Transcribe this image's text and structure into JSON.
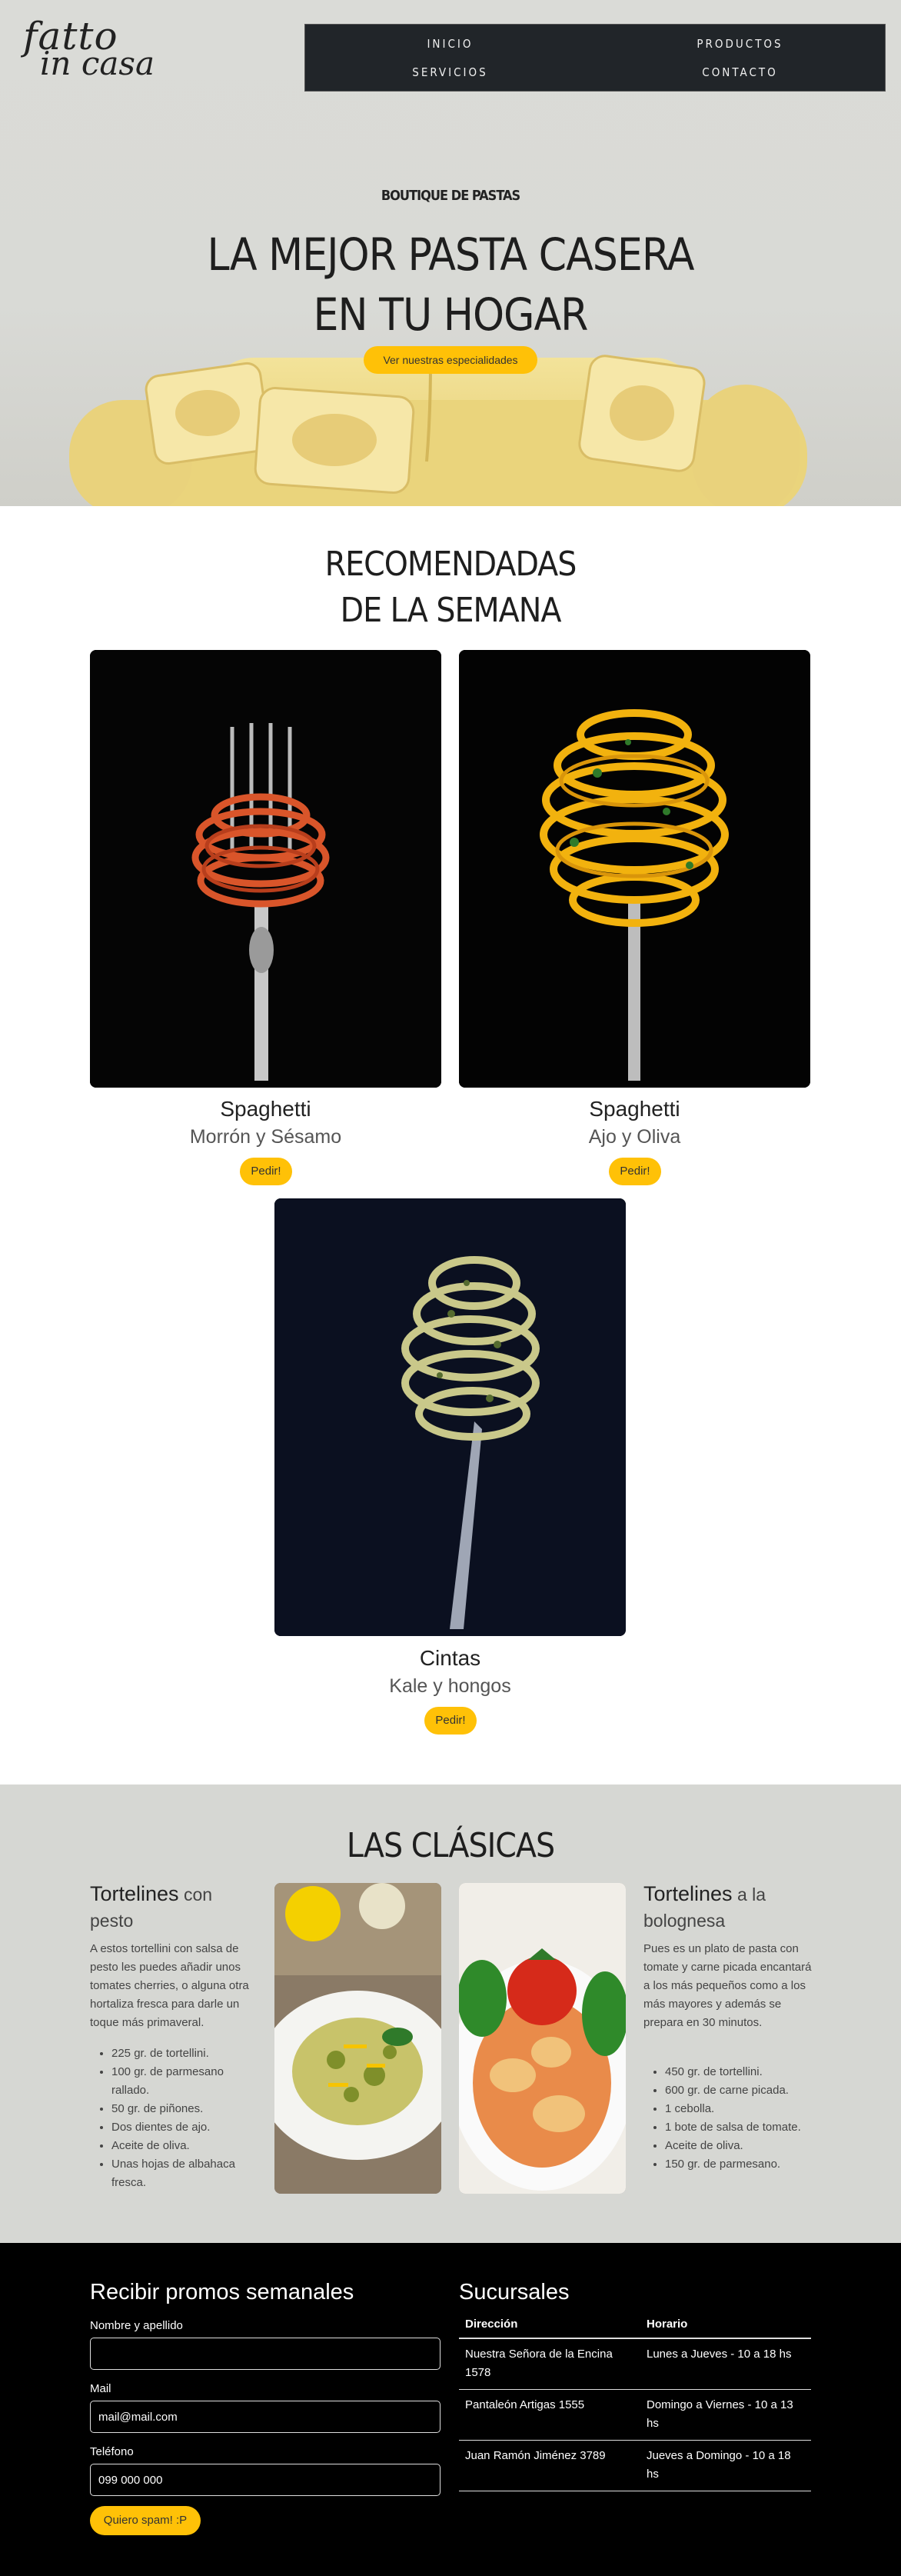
{
  "header": {
    "logo_line1": "fatto",
    "logo_line2": "in casa",
    "nav": [
      "INICIO",
      "PRODUCTOS",
      "SERVICIOS",
      "CONTACTO"
    ]
  },
  "hero": {
    "subtitle": "BOUTIQUE DE PASTAS",
    "title_line1": "LA MEJOR PASTA CASERA",
    "title_line2": "EN TU HOGAR",
    "button": "Ver nuestras especialidades"
  },
  "recomendadas": {
    "title_line1": "RECOMENDADAS",
    "title_line2": "DE LA SEMANA",
    "items": [
      {
        "name": "Spaghetti",
        "sub": "Morrón y Sésamo",
        "button": "Pedir!"
      },
      {
        "name": "Spaghetti",
        "sub": "Ajo y Oliva",
        "button": "Pedir!"
      },
      {
        "name": "Cintas",
        "sub": "Kale y hongos",
        "button": "Pedir!"
      }
    ]
  },
  "clasicas": {
    "title": "LAS CLÁSICAS",
    "left": {
      "name": "Tortelines",
      "name_rest": " con pesto",
      "description": "A estos tortellini con salsa de pesto les puedes añadir unos tomates cherries, o alguna otra hortaliza fresca para darle un toque más primaveral.",
      "ingredients": [
        "225 gr. de tortellini.",
        "100 gr. de parmesano rallado.",
        "50 gr. de piñones.",
        "Dos dientes de ajo.",
        "Aceite de oliva.",
        "Unas hojas de albahaca fresca."
      ]
    },
    "right": {
      "name": "Tortelines",
      "name_rest": " a la bolognesa",
      "description": "Pues es un plato de pasta con tomate y carne picada encantará a los más pequeños como a los más mayores y además se prepara en 30 minutos.",
      "ingredients": [
        "450 gr. de tortellini.",
        "600 gr. de carne picada.",
        "1 cebolla.",
        "1 bote de salsa de tomate.",
        "Aceite de oliva.",
        "150 gr. de parmesano."
      ]
    }
  },
  "footer": {
    "promo_title": "Recibir promos semanales",
    "name_label": "Nombre y apellido",
    "name_value": "",
    "mail_label": "Mail",
    "mail_placeholder": "mail@mail.com",
    "phone_label": "Teléfono",
    "phone_placeholder": "099 000 000",
    "submit": "Quiero spam! :P",
    "branches_title": "Sucursales",
    "table_headers": [
      "Dirección",
      "Horario"
    ],
    "rows": [
      [
        "Nuestra Señora de la Encina 1578",
        "Lunes a Jueves - 10 a 18 hs"
      ],
      [
        "Pantaleón Artigas 1555",
        "Domingo a Viernes - 10 a 13 hs"
      ],
      [
        "Juan Ramón Jiménez 3789",
        "Jueves a Domingo - 10 a 18 hs"
      ]
    ]
  },
  "colors": {
    "accent": "#ffc107",
    "nav_bg": "#212529",
    "hero_bg": "#dadbd7",
    "footer_bg": "#000000"
  }
}
